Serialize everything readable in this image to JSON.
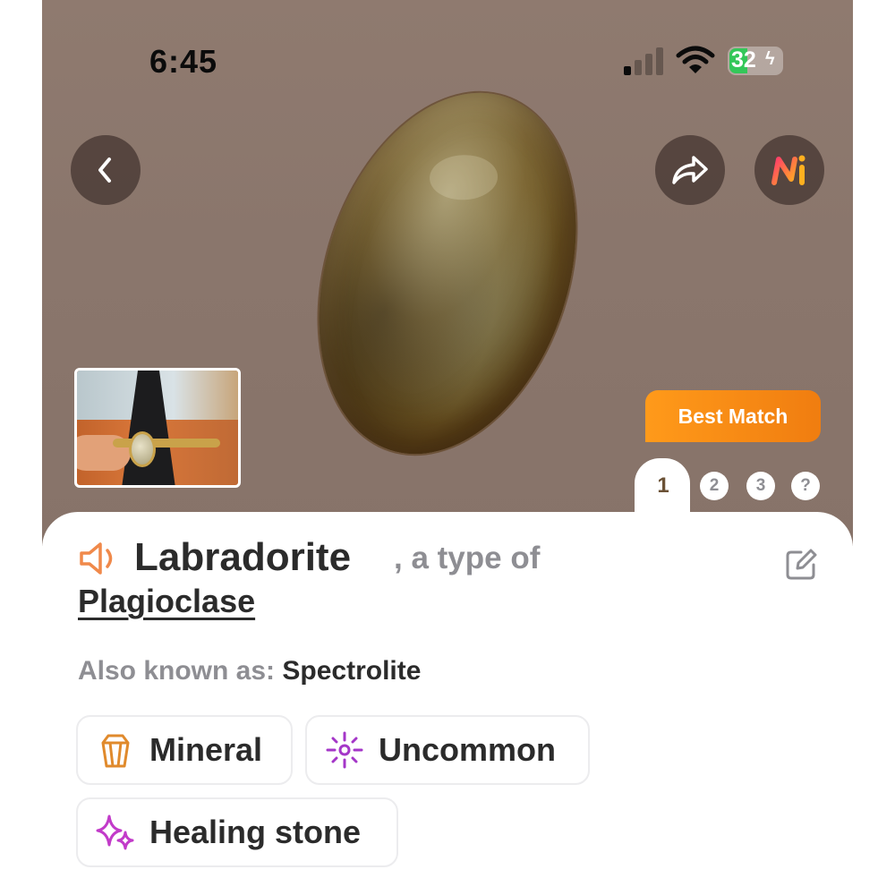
{
  "status_bar": {
    "time": "6:45",
    "battery": "32"
  },
  "hero": {
    "badge": "Best Match",
    "pages": [
      "1",
      "2",
      "3",
      "?"
    ],
    "active_page": "1"
  },
  "result": {
    "name": "Labradorite",
    "type_prefix": ", a type of",
    "parent": "Plagioclase",
    "aka_label": "Also known as:",
    "aka_value": "Spectrolite"
  },
  "tags": [
    {
      "label": "Mineral",
      "icon": "crystal-icon",
      "color": "#e08a2c"
    },
    {
      "label": "Uncommon",
      "icon": "sparkle-sun-icon",
      "color": "#a436c8"
    },
    {
      "label": "Healing stone",
      "icon": "sparkles-icon",
      "color": "#c23bc9"
    }
  ],
  "colors": {
    "accent_orange": "#f58a14",
    "text_dark": "#2b2b2b",
    "text_gray": "#8e8e93"
  }
}
